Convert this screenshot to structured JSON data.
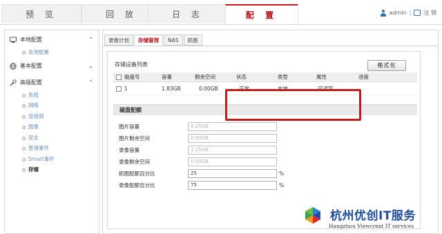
{
  "nav": {
    "tabs": [
      {
        "label": "预 览"
      },
      {
        "label": "回 放"
      },
      {
        "label": "日 志"
      },
      {
        "label": "配 置"
      }
    ],
    "user": "admin",
    "separator": "|",
    "logout": "注 销"
  },
  "sidebar": {
    "groups": [
      {
        "label": "本地配置",
        "chevron": "⌃",
        "icon": "monitor-icon",
        "items": [
          {
            "label": "本地配置"
          }
        ]
      },
      {
        "label": "基本配置",
        "chevron": "⌄",
        "icon": "globe-icon",
        "items": []
      },
      {
        "label": "高级配置",
        "chevron": "⌃",
        "icon": "wrench-icon",
        "items": [
          {
            "label": "系统"
          },
          {
            "label": "网络"
          },
          {
            "label": "音视频"
          },
          {
            "label": "图像"
          },
          {
            "label": "安全"
          },
          {
            "label": "普通事件"
          },
          {
            "label": "Smart事件"
          },
          {
            "label": "存储"
          }
        ]
      }
    ]
  },
  "subtabs": [
    {
      "label": "录像计划"
    },
    {
      "label": "存储管理"
    },
    {
      "label": "NAS"
    },
    {
      "label": "抓图"
    }
  ],
  "storage": {
    "list_title": "存储设备列表",
    "format_button": "格式化",
    "columns": [
      "磁盘号",
      "容量",
      "剩余空间",
      "状态",
      "类型",
      "属性",
      "进度"
    ],
    "rows": [
      {
        "disk": "1",
        "capacity": "1.83GB",
        "free": "0.00GB",
        "status": "正常",
        "type": "本地",
        "attr": "可读写",
        "progress": ""
      }
    ]
  },
  "quota": {
    "section_title": "磁盘配额",
    "fields": [
      {
        "label": "图片容量",
        "value": "0.25GB",
        "unit": ""
      },
      {
        "label": "图片剩余空间",
        "value": "0.00GB",
        "unit": ""
      },
      {
        "label": "录像容量",
        "value": "1.25GB",
        "unit": ""
      },
      {
        "label": "录像剩余空间",
        "value": "0.00GB",
        "unit": ""
      },
      {
        "label": "抓图配额百分比",
        "value": "25",
        "unit": "%"
      },
      {
        "label": "录像配额百分比",
        "value": "75",
        "unit": "%"
      }
    ]
  },
  "watermark": {
    "title": "杭州优创IT服务",
    "subtitle": "Hangzhou Viewcreat IT services"
  },
  "colors": {
    "accent": "#c8161d",
    "link": "#6d8fb8",
    "highlight_box": "#c41a1a",
    "watermark_blue": "#1f4e9e"
  }
}
